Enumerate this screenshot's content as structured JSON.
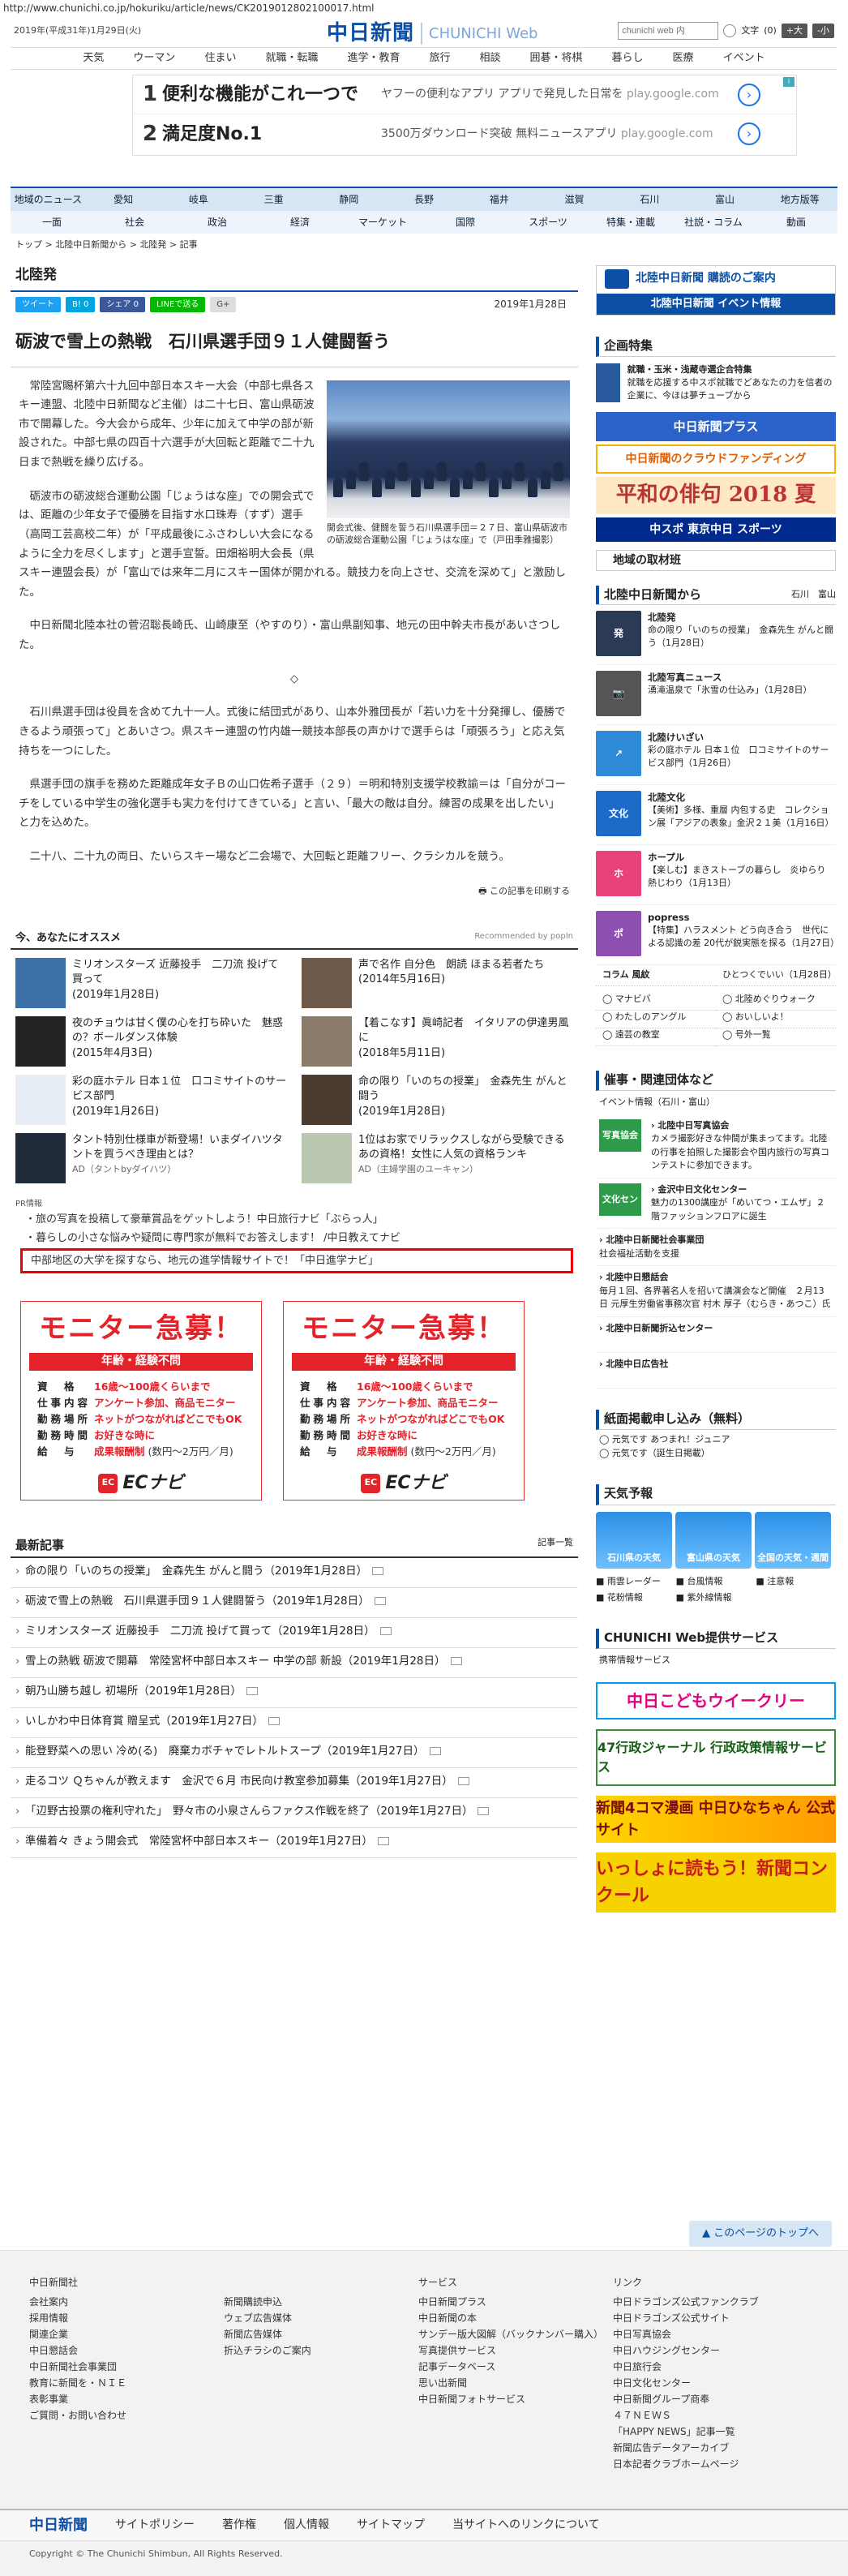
{
  "url": "http://www.chunichi.co.jp/hokuriku/article/news/CK2019012802100017.html",
  "header": {
    "date": "2019年(平成31年)1月29日(火)",
    "logo": "中日新聞",
    "logo_web": "CHUNICHI Web",
    "search_placeholder": "chunichi web 内",
    "font_label": "文字",
    "font_size_value": "(0)",
    "font_plus": "+大",
    "font_minus": "-小"
  },
  "globalnav": [
    "天気",
    "ウーマン",
    "住まい",
    "就職・転職",
    "進学・教育",
    "旅行",
    "相談",
    "囲碁・将棋",
    "暮らし",
    "医療",
    "イベント"
  ],
  "ads": [
    {
      "num": "1",
      "title": "便利な機能がこれ一つで",
      "desc": "ヤフーの便利なアプリ アプリで発見した日常を",
      "domain": "play.google.com"
    },
    {
      "num": "2",
      "title": "満足度No.1",
      "desc": "3500万ダウンロード突破 無料ニュースアプリ",
      "domain": "play.google.com"
    }
  ],
  "secnav_row1": [
    "地域のニュース",
    "愛知",
    "岐阜",
    "三重",
    "静岡",
    "長野",
    "福井",
    "滋賀",
    "石川",
    "富山",
    "地方版等"
  ],
  "secnav_row2": [
    "一面",
    "社会",
    "政治",
    "経済",
    "マーケット",
    "国際",
    "スポーツ",
    "特集・連載",
    "社説・コラム",
    "動画"
  ],
  "breadcrumb": "トップ > 北陸中日新聞から > 北陸発 > 記事",
  "page_title": "北陸発",
  "share": {
    "tweet": "ツイート",
    "hatena": "B! 0",
    "fb": "シェア 0",
    "line": "LINEで送る",
    "gplus": "G+",
    "date": "2019年1月28日"
  },
  "article": {
    "headline": "砺波で雪上の熱戦　石川県選手団９１人健闘誓う",
    "caption": "開会式後、健闘を誓う石川県選手団＝２７日、富山県砺波市の砺波総合運動公園「じょうはな座」で（戸田季雅撮影）",
    "p1": "常陸宮賜杯第六十九回中部日本スキー大会（中部七県各スキー連盟、北陸中日新聞など主催）は二十七日、富山県砺波市で開幕した。今大会から成年、少年に加えて中学の部が新設された。中部七県の四百十六選手が大回転と距離で二十九日まで熱戦を繰り広げる。",
    "p2": "砺波市の砺波総合運動公園「じょうはな座」での開会式では、距離の少年女子で優勝を目指す水口珠寿（すず）選手（高岡工芸高校二年）が「平成最後にふさわしい大会になるように全力を尽くします」と選手宣誓。田畑裕明大会長（県スキー連盟会長）が「富山では来年二月にスキー国体が開かれる。競技力を向上させ、交流を深めて」と激励した。",
    "p3": "中日新聞北陸本社の菅沼聡長崎氏、山崎康至（やすのり）・富山県副知事、地元の田中幹夫市長があいさつした。",
    "mark": "◇",
    "p4": "石川県選手団は役員を含めて九十一人。式後に結団式があり、山本外雅団長が「若い力を十分発揮し、優勝できるよう頑張って」とあいさつ。県スキー連盟の竹内雄一競技本部長の声かけで選手らは「頑張ろう」と応え気持ちを一つにした。",
    "p5": "県選手団の旗手を務めた距離成年女子Ｂの山口佐希子選手（２９）＝明和特別支援学校教諭＝は「自分がコーチをしている中学生の強化選手も実力を付けてきている」と言い、「最大の敵は自分。練習の成果を出したい」と力を込めた。",
    "p6": "二十八、二十九の両日、たいらスキー場など二会場で、大回転と距離フリー、クラシカルを競う。",
    "print": "この記事を印刷する"
  },
  "recommend": {
    "title": "今、あなたにオススメ",
    "by": "Recommended by popIn",
    "items": [
      {
        "title": "ミリオンスターズ 近藤投手　二刀流 投げて買って",
        "date": "(2019年1月28日)",
        "color": "#3a6fa8"
      },
      {
        "title": "声で名作 自分色　朗読 ほまる若者たち",
        "date": "(2014年5月16日)",
        "color": "#6d5a4a"
      },
      {
        "title": "夜のチョウは甘く僕の心を打ち砕いた　魅惑の？ボールダンス体験",
        "date": "(2015年4月3日)",
        "color": "#222"
      },
      {
        "title": "【着こなす】眞崎記者　イタリアの伊達男風に",
        "date": "(2018年5月11日)",
        "color": "#8a7b6b"
      },
      {
        "title": "彩の庭ホテル 日本１位　口コミサイトのサービス部門",
        "date": "(2019年1月26日)",
        "color": "#e8eef5"
      },
      {
        "title": "命の限り「いのちの授業」　金森先生 がんと闘う",
        "date": "(2019年1月28日)",
        "color": "#4a3c30"
      },
      {
        "title": "タント特別仕様車が新登場！いまダイハツタントを買うべき理由とは？",
        "date": "AD（タントbyダイハツ）",
        "color": "#1f2b3a"
      },
      {
        "title": "1位はお家でリラックスしながら受験できるあの資格！女性に人気の資格ランキ",
        "date": "AD（主婦学園のユーキャン）",
        "color": "#b9c7b0"
      }
    ]
  },
  "pr": {
    "label": "PR情報",
    "items": [
      "旅の写真を投稿して豪華賞品をゲットしよう！中日旅行ナビ「ぶらっ人」",
      "暮らしの小さな悩みや疑問に専門家が無料でお答えします！ /中日教えてナビ"
    ],
    "highlight": "中部地区の大学を探すなら、地元の進学情報サイトで！「中日進学ナビ」"
  },
  "monitor": {
    "big": "モニター急募！",
    "band": "年齢・経験不問",
    "rows": [
      {
        "k": "資　格",
        "v": "16歳～100歳くらいまで"
      },
      {
        "k": "仕事内容",
        "v": "アンケート参加、商品モニター"
      },
      {
        "k": "勤務場所",
        "v": "ネットがつながればどこでもOK"
      },
      {
        "k": "勤務時間",
        "v": "お好きな時に"
      },
      {
        "k": "給　与",
        "v": "成果報酬制",
        "small": "(数円～2万円／月)"
      }
    ],
    "brand": "ECナビ"
  },
  "latest": {
    "title": "最新記事",
    "more": "記事一覧",
    "items": [
      "命の限り「いのちの授業」　金森先生 がんと闘う（2019年1月28日）",
      "砺波で雪上の熱戦　石川県選手団９１人健闘誓う（2019年1月28日）",
      "ミリオンスターズ 近藤投手　二刀流 投げて買って（2019年1月28日）",
      "雪上の熱戦 砺波で開幕　常陸宮杯中部日本スキー 中学の部 新設（2019年1月28日）",
      "朝乃山勝ち越し 初場所（2019年1月28日）",
      "いしかわ中日体育賞 贈呈式（2019年1月27日）",
      "能登野菜への思い 冷め(る)　廃棄カボチャでレトルトスープ（2019年1月27日）",
      "走るコツ Ｑちゃんが教えます　金沢で６月 市民向け教室参加募集（2019年1月27日）",
      "「辺野古投票の権利守れた」　野々市の小泉さんらファクス作戦を終了（2019年1月27日）",
      "準備着々 きょう開会式　常陸宮杯中部日本スキー（2019年1月27日）"
    ]
  },
  "sidebar": {
    "subscribe": "北陸中日新聞 購読のご案内",
    "subscribe_btn": "購読",
    "event": "北陸中日新聞 イベント情報",
    "feature_h": "企画特集",
    "feature_title": "就職・玉米・浅蔵寺選企合特集",
    "feature_desc": "就職を応援する中スポ就職でどあなたの力を信者の企業に、今ほは夢チューブから",
    "banners": [
      "中日新聞プラス",
      "中日新聞のクラウドファンディング",
      "平和の俳句 2018 夏",
      "中スポ 東京中日 スポーツ"
    ],
    "region": "地域の取材班",
    "hokuriku_h": "北陸中日新聞から",
    "hokuriku_links": "石川　富山",
    "hokuriku_items": [
      {
        "cat": "北陸発",
        "text": "命の限り「いのちの授業」　金森先生 がんと闘う（1月28日）",
        "color": "#2b3a55",
        "icon": "発"
      },
      {
        "cat": "北陸写真ニュース",
        "text": "湧滝温泉で「氷雪の仕込み」（1月28日）",
        "color": "#555",
        "icon": "📷"
      },
      {
        "cat": "北陸けいざい",
        "text": "彩の庭ホテル 日本１位　口コミサイトのサービス部門（1月26日）",
        "color": "#2f8ad8",
        "icon": "↗"
      },
      {
        "cat": "北陸文化",
        "text": "【美術】多様、重層 内包する史　コレクション展「アジアの表象」金沢２１美（1月16日）",
        "color": "#1d6bc8",
        "icon": "文化"
      },
      {
        "cat": "ホープル",
        "text": "【楽しむ】まきストーブの暮らし　炎ゆらり 熱じわり（1月13日）",
        "color": "#e8427a",
        "icon": "ホ"
      },
      {
        "cat": "popress",
        "text": "【特集】ハラスメント どう向き合う　世代による認識の差 20代が鋭実態を探る（1月27日）",
        "color": "#8d4fb0",
        "icon": "ポ"
      }
    ],
    "column_h": "コラム 風紋",
    "column_text": "ひとつくでいい（1月28日）",
    "links": [
      "マナビバ",
      "北陸めぐりウォーク",
      "わたしのアングル",
      "おいしいよ！",
      "遠芸の教室",
      "号外一覧"
    ],
    "events_h": "催事・関連団体など",
    "events_sub": "イベント情報（石川・富山）",
    "events": [
      {
        "h": "北陸中日写真協会",
        "t": "カメラ撮影好きな仲間が集まってます。北陸の行事を拍照した撮影会や国内旅行の写真コンテストに参加できます。",
        "ico": "写真協会"
      },
      {
        "h": "金沢中日文化センター",
        "t": "魅力の1300講座が「めいてつ・エムザ」２階ファッションフロアに誕生",
        "ico": "文化センター"
      },
      {
        "h": "北陸中日新聞社会事業団",
        "t": "社会福祉活動を支援",
        "ico": ""
      },
      {
        "h": "北陸中日懇話会",
        "t": "毎月１回、各界著名人を招いて講演会など開催　２月13日 元厚生労働省事務次官 村木 厚子（むらき・あつこ）氏",
        "ico": ""
      },
      {
        "h": "北陸中日新聞折込センター",
        "t": "",
        "ico": ""
      },
      {
        "h": "北陸中日広告社",
        "t": "",
        "ico": ""
      }
    ],
    "paper_h": "紙面掲載申し込み（無料）",
    "paper_items": [
      "元気です あつまれ！ジュニア",
      "元気です（誕生日掲載）"
    ],
    "weather_h": "天気予報",
    "weather": [
      "石川県の天気",
      "富山県の天気",
      "全国の天気・週間"
    ],
    "weather_links": [
      "雨雲レーダー",
      "台風情報",
      "注意報",
      "花粉情報",
      "紫外線情報"
    ],
    "service_h": "CHUNICHI Web提供サービス",
    "service_sub": "携帯情報サービス",
    "bottom_banners": [
      "中日こどもウイークリー",
      "47行政ジャーナル 行政政策情報サービス",
      "新聞4コマ漫画 中日ひなちゃん 公式サイト",
      "いっしょに読もう！新聞コンクール"
    ]
  },
  "pagetop": "このページのトップへ",
  "footer": {
    "cols": [
      {
        "h": "中日新聞社",
        "items": [
          "会社案内",
          "採用情報",
          "関連企業",
          "中日懇話会",
          "中日新聞社会事業団",
          "教育に新聞を・ＮＩＥ",
          "表彰事業",
          "ご質問・お問い合わせ"
        ]
      },
      {
        "h": "",
        "items": [
          "新聞購読申込",
          "ウェブ広告媒体",
          "新聞広告媒体",
          "折込チラシのご案内"
        ]
      },
      {
        "h": "サービス",
        "items": [
          "中日新聞プラス",
          "中日新聞の本",
          "サンデー版大図解（バックナンバー購入）",
          "写真提供サービス",
          "記事データベース",
          "思い出新聞",
          "中日新聞フォトサービス"
        ]
      },
      {
        "h": "リンク",
        "items": [
          "中日ドラゴンズ公式ファンクラブ",
          "中日ドラゴンズ公式サイト",
          "中日写真協会",
          "中日ハウジングセンター",
          "中日旅行会",
          "中日文化センター",
          "中日新聞グループ商奉",
          "４７ＮＥＷＳ",
          "「HAPPY NEWS」記事一覧",
          "新聞広告データアーカイブ",
          "日本記者クラブホームページ"
        ]
      }
    ],
    "logo": "中日新聞",
    "nav": [
      "サイトポリシー",
      "著作権",
      "個人情報",
      "サイトマップ",
      "当サイトへのリンクについて"
    ],
    "copyright": "Copyright © The Chunichi Shimbun, All Rights Reserved."
  }
}
